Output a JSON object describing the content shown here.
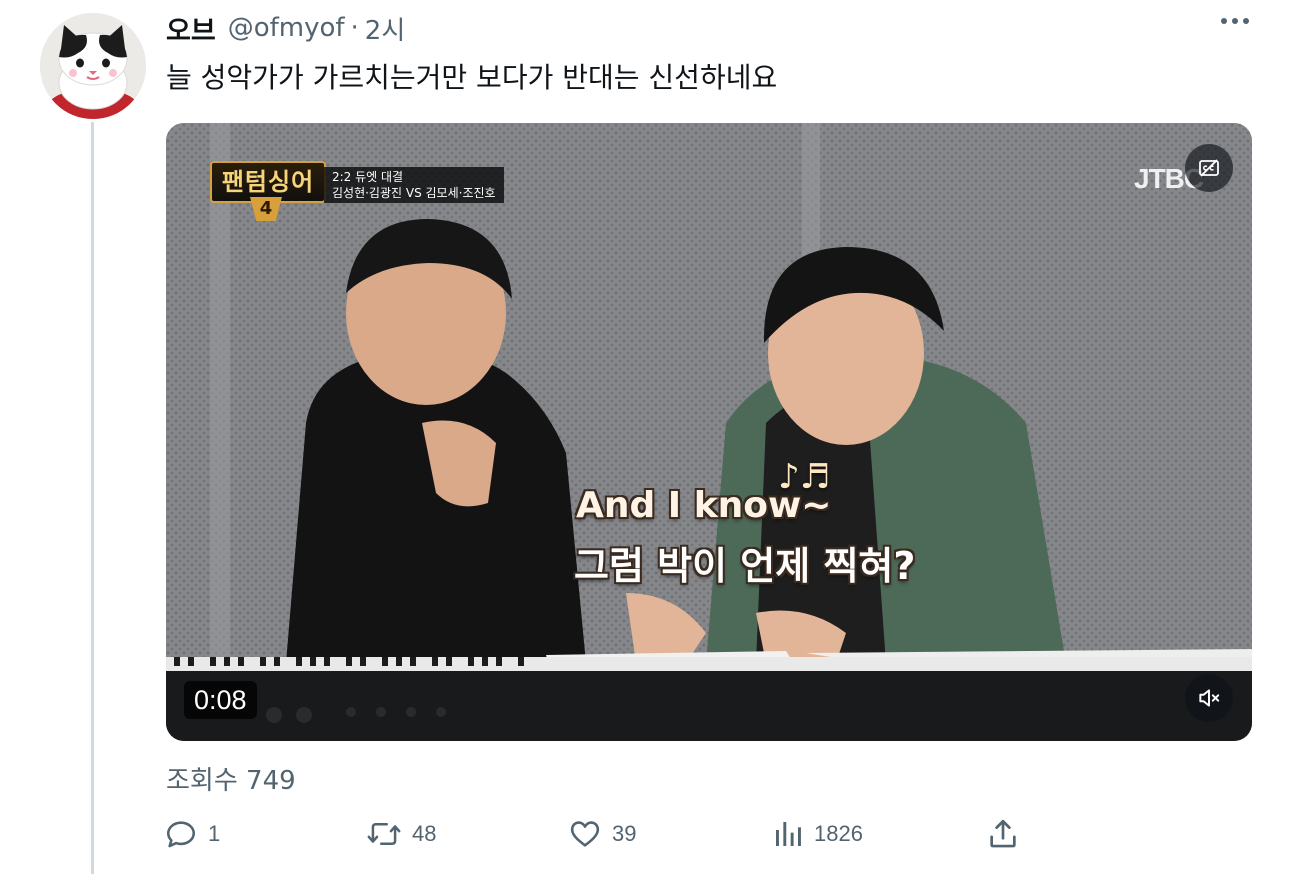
{
  "tweet": {
    "display_name": "오브",
    "handle": "@ofmyof",
    "separator": "·",
    "time_ago": "2시",
    "text": "늘 성악가가 가르치는거만 보다가 반대는 신선하네요",
    "views_label": "조회수",
    "views_count": "749"
  },
  "video": {
    "timestamp": "0:08",
    "show_title": "팬텀싱어",
    "show_number": "4",
    "round_label": "2:2 듀엣 대결",
    "matchup": "김성현·김광진 VS 김모세·조진호",
    "broadcaster": "JTBC",
    "subtitle_line1": "And I know~",
    "subtitle_line2": "그럼 박이 언제 찍혀?",
    "notes_glyph": "♪♬"
  },
  "actions": {
    "reply_count": "1",
    "retweet_count": "48",
    "like_count": "39",
    "views_count": "1826"
  },
  "icons": {
    "more": "more-icon",
    "reply": "reply-icon",
    "retweet": "retweet-icon",
    "like": "heart-icon",
    "analytics": "analytics-icon",
    "share": "share-icon",
    "captions": "captions-icon",
    "mute": "mute-icon"
  },
  "colors": {
    "secondary_text": "#536471",
    "primary_text": "#0f1419",
    "thread_line": "#cfd9de"
  }
}
